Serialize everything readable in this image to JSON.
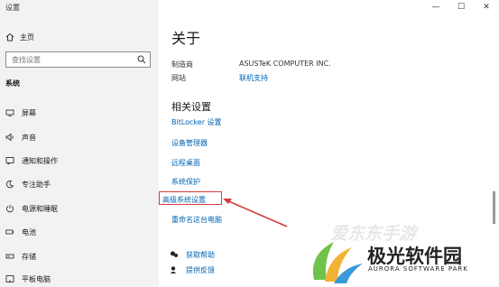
{
  "window": {
    "title": "设置",
    "minimize": "—",
    "maximize": "☐",
    "close": "✕"
  },
  "sidebar": {
    "home_label": "主页",
    "search_placeholder": "查找设置",
    "section_label": "系统",
    "items": [
      {
        "label": "屏幕",
        "icon": "display-icon"
      },
      {
        "label": "声音",
        "icon": "speaker-icon"
      },
      {
        "label": "通知和操作",
        "icon": "notification-icon"
      },
      {
        "label": "专注助手",
        "icon": "moon-icon"
      },
      {
        "label": "电源和睡眠",
        "icon": "power-icon"
      },
      {
        "label": "电池",
        "icon": "battery-icon"
      },
      {
        "label": "存储",
        "icon": "storage-icon"
      },
      {
        "label": "平板电脑",
        "icon": "tablet-icon"
      }
    ]
  },
  "main": {
    "title": "关于",
    "manufacturer_label": "制造商",
    "manufacturer_value": "ASUSTeK COMPUTER INC.",
    "website_label": "网站",
    "website_value": "联机支持",
    "related_title": "相关设置",
    "related_links": [
      "BitLocker 设置",
      "设备管理器",
      "远程桌面",
      "系统保护",
      "高级系统设置",
      "重命名这台电脑"
    ],
    "help": [
      {
        "label": "获取帮助",
        "icon": "help-icon"
      },
      {
        "label": "提供反馈",
        "icon": "feedback-icon"
      }
    ]
  },
  "watermarks": {
    "top_text": "爱东东手游",
    "brand_text": "极光软件园",
    "brand_sub": "AURORA SOFTWARE PARK"
  },
  "colors": {
    "link": "#0063b1",
    "highlight": "#d63c3c",
    "sidebar_bg": "#f2f2f2"
  }
}
